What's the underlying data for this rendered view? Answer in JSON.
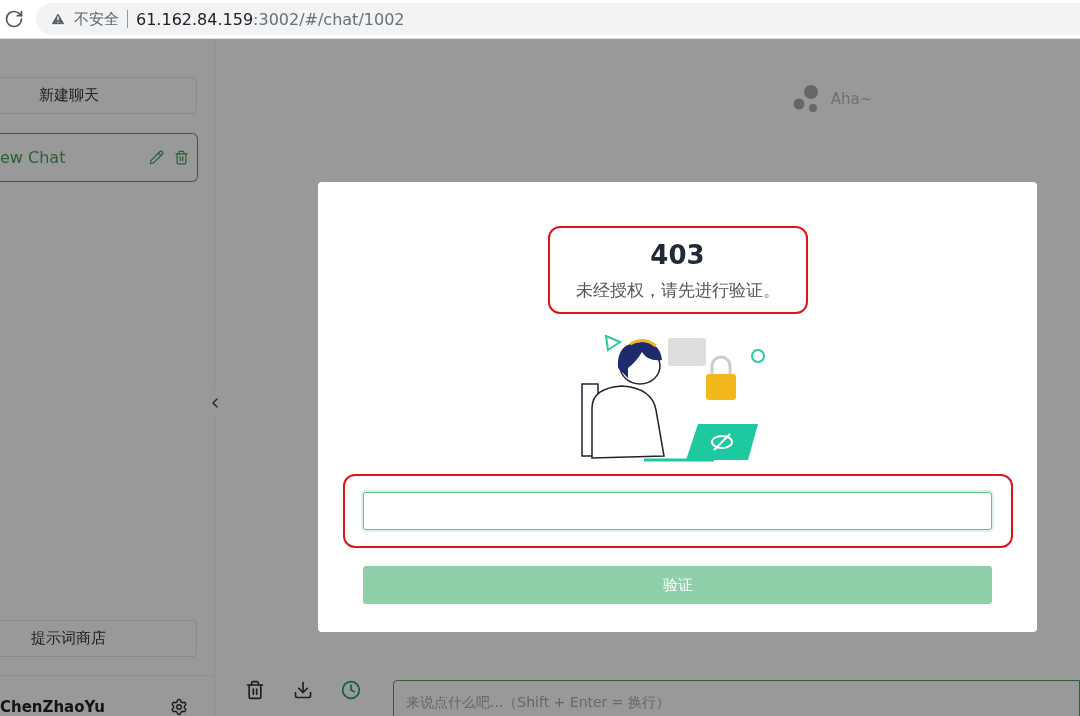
{
  "browser": {
    "security_label": "不安全",
    "url_host": "61.162.84.159",
    "url_path": ":3002/#/chat/1002"
  },
  "sidebar": {
    "new_chat_button": "新建聊天",
    "chats": [
      {
        "title": "ew Chat",
        "selected": true
      }
    ],
    "prompt_store_button": "提示词商店",
    "user_name": "ChenZhaoYu"
  },
  "header": {
    "title": "Aha~"
  },
  "footer": {
    "placeholder": "来说点什么吧...（Shift + Enter = 换行）"
  },
  "dialog": {
    "code": "403",
    "message": "未经授权，请先进行验证。",
    "input_focused": true,
    "verify_button": "验证",
    "verify_disabled": true
  }
}
